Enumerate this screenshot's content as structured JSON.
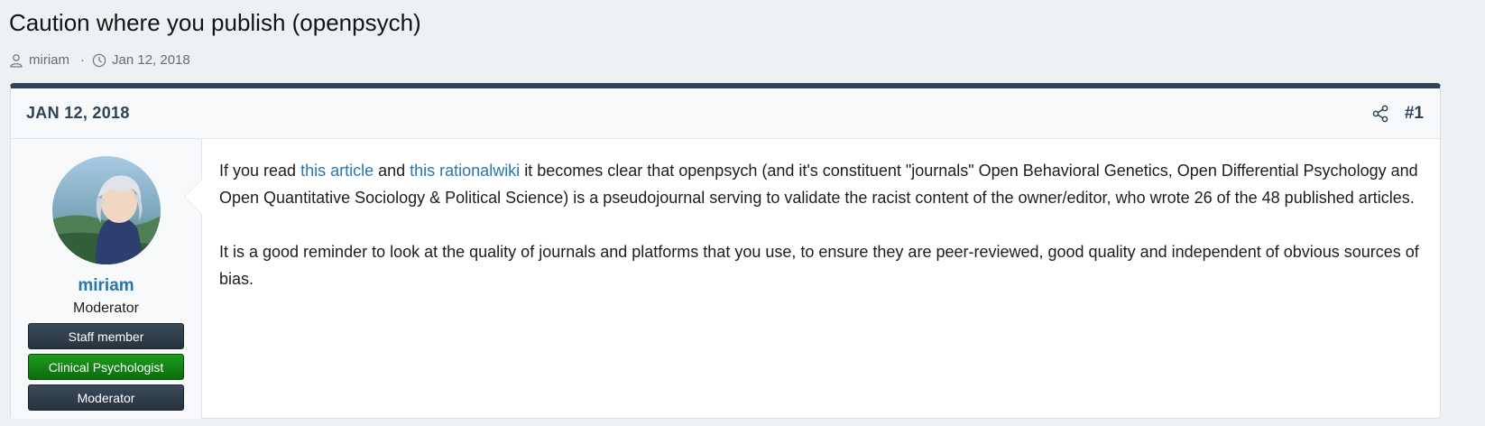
{
  "thread": {
    "title": "Caution where you publish (openpsych)",
    "author": "miriam",
    "separator": "·",
    "date": "Jan 12, 2018"
  },
  "post": {
    "date_header": "JAN 12, 2018",
    "number": "#1",
    "user": {
      "name": "miriam",
      "title": "Moderator",
      "banners": [
        "Staff member",
        "Clinical Psychologist",
        "Moderator"
      ]
    },
    "message": {
      "p1_prefix": "If you read ",
      "p1_link1": "this article",
      "p1_mid": " and ",
      "p1_link2": "this rationalwiki",
      "p1_suffix": " it becomes clear that openpsych (and it's constituent \"journals\" Open Behavioral Genetics, Open Differential Psychology and Open Quantitative Sociology & Political Science) is a pseudojournal serving to validate the racist content of the owner/editor, who wrote 26 of the 48 published articles.",
      "p2": "It is a good reminder to look at the quality of journals and platforms that you use, to ensure they are peer-reviewed, good quality and independent of obvious sources of bias."
    }
  },
  "icons": {
    "author": "user-icon",
    "date": "clock-icon",
    "share": "share-icon"
  },
  "colors": {
    "accent": "#2e4357",
    "link": "#2577b1",
    "clinical_banner": "#0a6e0a",
    "staff_banner": "#27333f"
  }
}
